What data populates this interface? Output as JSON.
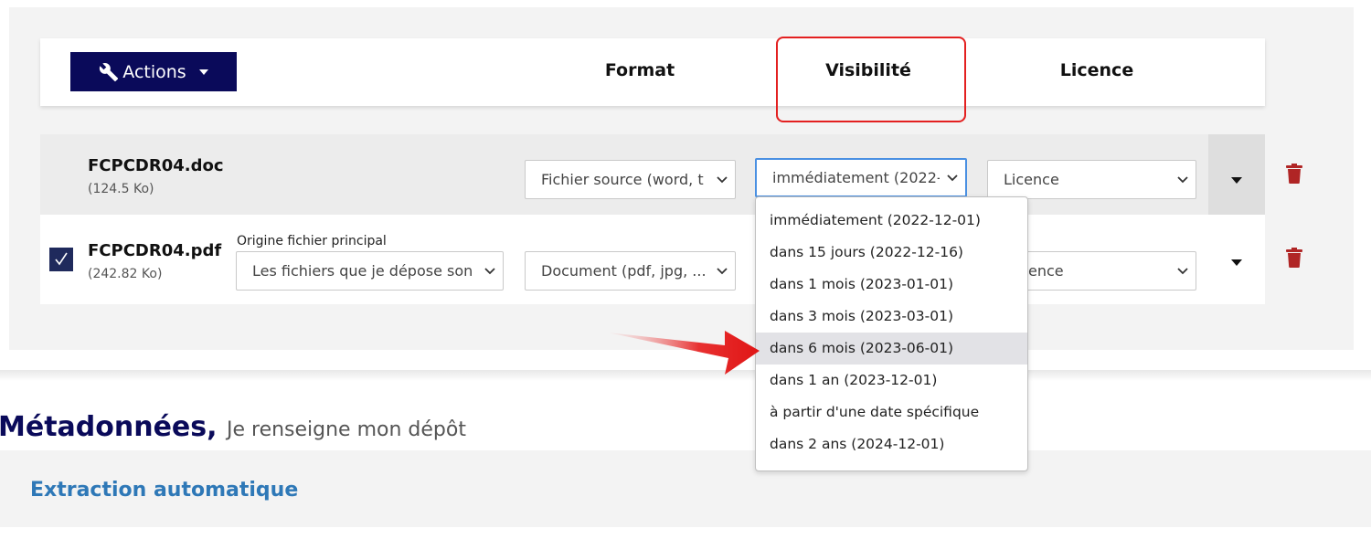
{
  "header": {
    "actions_label": "Actions",
    "columns": {
      "format": "Format",
      "visibility": "Visibilité",
      "licence": "Licence"
    }
  },
  "files": [
    {
      "name": "FCPCDR04.doc",
      "size": "(124.5 Ko)",
      "format": "Fichier source (word, t",
      "visibility": "immédiatement (2022-",
      "licence": "Licence"
    },
    {
      "name": "FCPCDR04.pdf",
      "size": "(242.82 Ko)",
      "checked": true,
      "origin_label": "Origine fichier principal",
      "origin": "Les fichiers que je dépose son",
      "format": "Document (pdf, jpg, ...",
      "licence": "ence"
    }
  ],
  "visibility_dropdown": {
    "options": [
      "immédiatement (2022-12-01)",
      "dans 15 jours (2022-12-16)",
      "dans 1 mois (2023-01-01)",
      "dans 3 mois (2023-03-01)",
      "dans 6 mois (2023-06-01)",
      "dans 1 an (2023-12-01)",
      "à partir d'une date spécifique",
      "dans 2 ans (2024-12-01)"
    ],
    "highlighted": "dans 6 mois (2023-06-01)"
  },
  "metadata": {
    "title": "Métadonnées,",
    "subtitle": "Je renseigne mon dépôt",
    "extraction_label": "Extraction automatique"
  },
  "colors": {
    "primary": "#0a0a5a",
    "highlight_border": "#e32020",
    "link_blue": "#2e78b7",
    "trash_red": "#b02525"
  }
}
